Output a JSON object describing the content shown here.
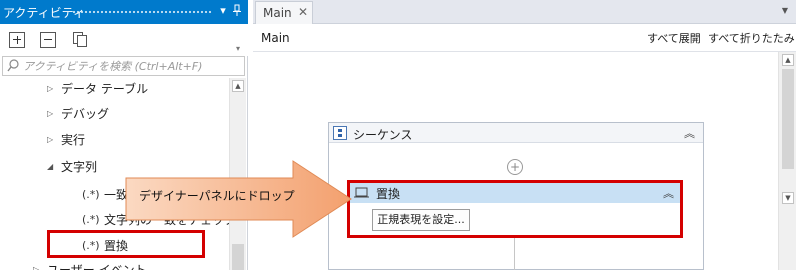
{
  "activities_panel": {
    "title": "アクティビティ",
    "pin_icon": "pin-icon",
    "menu_icon": "chevron-down-icon",
    "toolbar": [
      {
        "name": "expand-all-icon"
      },
      {
        "name": "collapse-all-icon"
      },
      {
        "name": "copy-documents-icon"
      }
    ],
    "search": {
      "placeholder": "アクティビティを検索 (Ctrl+Alt+F)",
      "value": ""
    },
    "tree": [
      {
        "label": "データ テーブル",
        "expanded": false
      },
      {
        "label": "デバッグ",
        "expanded": false
      },
      {
        "label": "実行",
        "expanded": false
      },
      {
        "label": "文字列",
        "expanded": true
      },
      {
        "label": "一致",
        "icon": "(.*)",
        "leaf": true
      },
      {
        "label": "文字列の一致をチェック",
        "icon": "(.*)",
        "leaf": true
      },
      {
        "label": "置換",
        "icon": "(.*)",
        "leaf": true,
        "highlighted": true
      },
      {
        "label": "ユーザー イベント",
        "expanded": false
      }
    ]
  },
  "designer": {
    "tab_label": "Main",
    "breadcrumb": "Main",
    "expand_all": "すべて展開",
    "collapse_all": "すべて折りたたみ",
    "sequence_label": "シーケンス",
    "replace_activity": {
      "label": "置換",
      "button_label": "正規表現を設定..."
    }
  },
  "callout": {
    "text": "デザイナーパネルにドロップ",
    "fill": "#f2a97c"
  },
  "colors": {
    "title_bar": "#007acc",
    "highlight": "#d40000",
    "activity_header": "#c8e0f4"
  }
}
